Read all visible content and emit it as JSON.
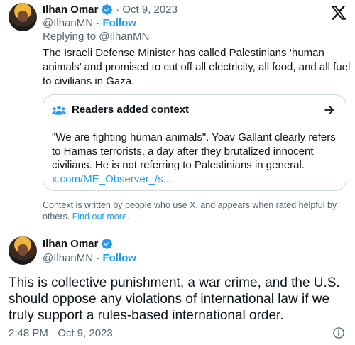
{
  "colors": {
    "accent": "#1d9bf0",
    "text": "#0f1419",
    "muted": "#536471",
    "border": "#cfd9de"
  },
  "quoted_tweet": {
    "author_name": "Ilhan Omar",
    "separator": "·",
    "date": "Oct 9, 2023",
    "handle": "@IlhanMN",
    "handle_sep": " · ",
    "follow_label": "Follow",
    "replying_to": "Replying to @IlhanMN",
    "text": "The Israeli Defense Minister has called Palestinians ‘human animals’ and promised to cut off all electricity, all food, and all fuel to civilians in Gaza.",
    "context_card": {
      "icon": "readers-group-icon",
      "title": "Readers added context",
      "arrow_icon": "arrow-right-icon",
      "body": "\"We are fighting human animals\". Yoav Gallant clearly refers to Hamas terrorists, a day after they brutalized innocent civilians. He is not referring to Palestinians in general.",
      "link": "x.com/ME_Observer_/s..."
    },
    "footnote": "Context is written by people who use X, and appears when rated helpful by others.",
    "footnote_link": "Find out more."
  },
  "main_tweet": {
    "author_name": "Ilhan Omar",
    "handle": "@IlhanMN",
    "handle_sep": " · ",
    "follow_label": "Follow",
    "text": "This is collective punishment, a war crime, and the U.S. should oppose any violations of international law if we truly support a rules-based international order.",
    "timestamp": "2:48 PM · Oct 9, 2023",
    "info_icon": "info-icon"
  },
  "brand_icon": "x-logo-icon"
}
